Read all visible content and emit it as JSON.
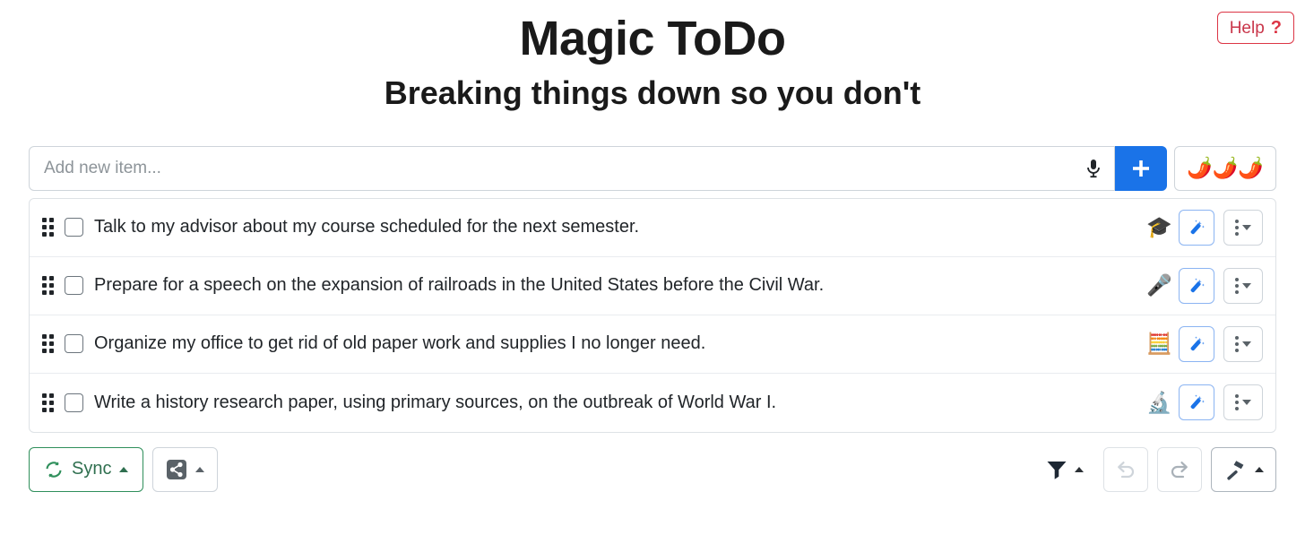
{
  "header": {
    "title": "Magic ToDo",
    "subtitle": "Breaking things down so you don't",
    "help_label": "Help",
    "help_icon_glyph": "?"
  },
  "add_bar": {
    "placeholder": "Add new item...",
    "value": "",
    "mic_icon": "microphone-icon",
    "add_icon": "plus-icon",
    "spice_level": "🌶️🌶️🌶️",
    "spice_count": 3,
    "accent_blue": "#1a73e8"
  },
  "tasks": [
    {
      "text": "Talk to my advisor about my course scheduled for the next semester.",
      "checked": false,
      "emoji": "🎓",
      "emoji_name": "graduation-cap-icon"
    },
    {
      "text": "Prepare for a speech on the expansion of railroads in the United States before the Civil War.",
      "checked": false,
      "emoji": "🎤",
      "emoji_name": "microphone-emoji-icon"
    },
    {
      "text": "Organize my office to get rid of old paper work and supplies I no longer need.",
      "checked": false,
      "emoji": "🧮",
      "emoji_name": "abacus-icon"
    },
    {
      "text": "Write a history research paper, using primary sources, on the outbreak of World War I.",
      "checked": false,
      "emoji": "🔬",
      "emoji_name": "microscope-icon"
    }
  ],
  "footer": {
    "sync_label": "Sync",
    "sync_color": "#2f6f4f",
    "share_icon": "share-icon",
    "filter_icon": "filter-icon",
    "undo_icon": "undo-icon",
    "redo_icon": "redo-icon",
    "tools_icon": "hammer-icon"
  }
}
